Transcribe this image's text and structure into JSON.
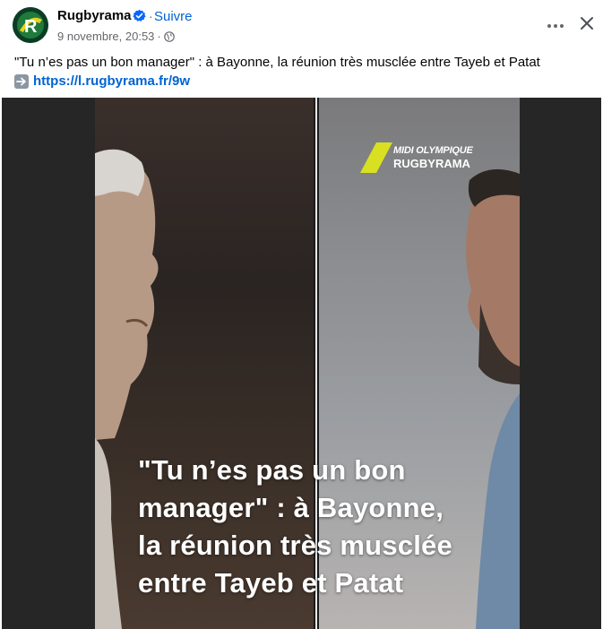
{
  "post": {
    "page_name": "Rugbyrama",
    "verified_icon": "verified-badge-icon",
    "separator": "·",
    "follow_label": "Suivre",
    "date": "9 novembre, 20:53",
    "meta_sep": "·",
    "privacy_icon": "globe-icon",
    "more_icon": "more-icon",
    "close_icon": "close-icon"
  },
  "caption": {
    "text": "\"Tu n’es pas un bon manager\" : à Bayonne, la réunion très musclée entre Tayeb et Patat",
    "arrow_icon": "right-arrow-emoji-icon",
    "link": "https://l.rugbyrama.fr/9w"
  },
  "media": {
    "brand_line1": "MIDI OLYMPIQUE",
    "brand_line2": "RUGBYRAMA",
    "headline_lines": [
      "\"Tu n’es pas un bon",
      "manager\" : à Bayonne,",
      "la réunion très musclée",
      "entre Tayeb et Patat"
    ]
  },
  "colors": {
    "link": "#0064d1",
    "muted": "#65676b",
    "verified": "#0866ff",
    "brand_yellow": "#d8e021"
  }
}
